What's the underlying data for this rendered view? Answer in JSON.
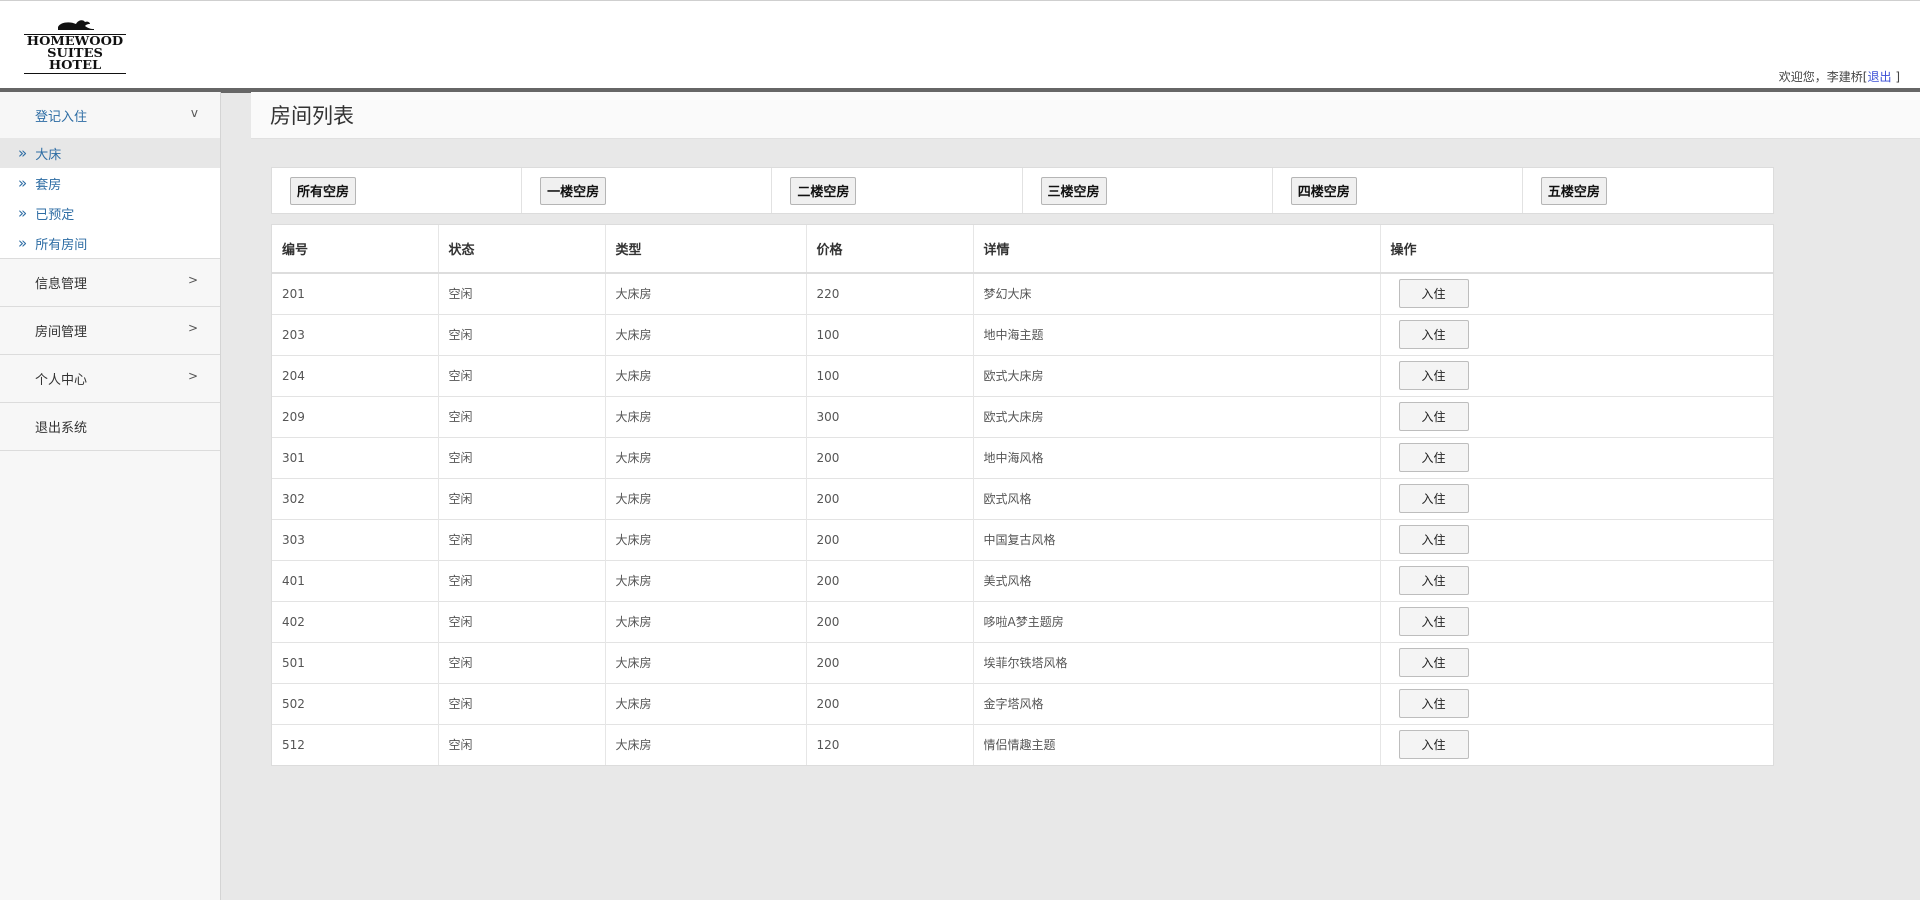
{
  "logo": {
    "line1": "HOMEWOOD",
    "line2": "SUITES",
    "line3": "HOTEL"
  },
  "user": {
    "greeting": "欢迎您，李建桥[",
    "logout": "退出",
    "suffix": " ]"
  },
  "sidebar": {
    "checkin": {
      "label": "登记入住",
      "arrow": "v"
    },
    "checkin_items": [
      {
        "label": "大床",
        "icon": "»"
      },
      {
        "label": "套房",
        "icon": "»"
      },
      {
        "label": "已预定",
        "icon": "»"
      },
      {
        "label": "所有房间",
        "icon": "»"
      }
    ],
    "groups": [
      {
        "label": "信息管理",
        "arrow": ">"
      },
      {
        "label": "房间管理",
        "arrow": ">"
      },
      {
        "label": "个人中心",
        "arrow": ">"
      }
    ],
    "exit": {
      "label": "退出系统"
    }
  },
  "page": {
    "title": "房间列表"
  },
  "filters": [
    "所有空房",
    "一楼空房",
    "二楼空房",
    "三楼空房",
    "四楼空房",
    "五楼空房"
  ],
  "table": {
    "headers": [
      "编号",
      "状态",
      "类型",
      "价格",
      "详情",
      "操作"
    ],
    "action_label": "入住",
    "rows": [
      [
        "201",
        "空闲",
        "大床房",
        "220",
        "梦幻大床"
      ],
      [
        "203",
        "空闲",
        "大床房",
        "100",
        "地中海主题"
      ],
      [
        "204",
        "空闲",
        "大床房",
        "100",
        "欧式大床房"
      ],
      [
        "209",
        "空闲",
        "大床房",
        "300",
        "欧式大床房"
      ],
      [
        "301",
        "空闲",
        "大床房",
        "200",
        "地中海风格"
      ],
      [
        "302",
        "空闲",
        "大床房",
        "200",
        "欧式风格"
      ],
      [
        "303",
        "空闲",
        "大床房",
        "200",
        "中国复古风格"
      ],
      [
        "401",
        "空闲",
        "大床房",
        "200",
        "美式风格"
      ],
      [
        "402",
        "空闲",
        "大床房",
        "200",
        "哆啦A梦主题房"
      ],
      [
        "501",
        "空闲",
        "大床房",
        "200",
        "埃菲尔铁塔风格"
      ],
      [
        "502",
        "空闲",
        "大床房",
        "200",
        "金字塔风格"
      ],
      [
        "512",
        "空闲",
        "大床房",
        "120",
        "情侣情趣主题"
      ]
    ]
  }
}
